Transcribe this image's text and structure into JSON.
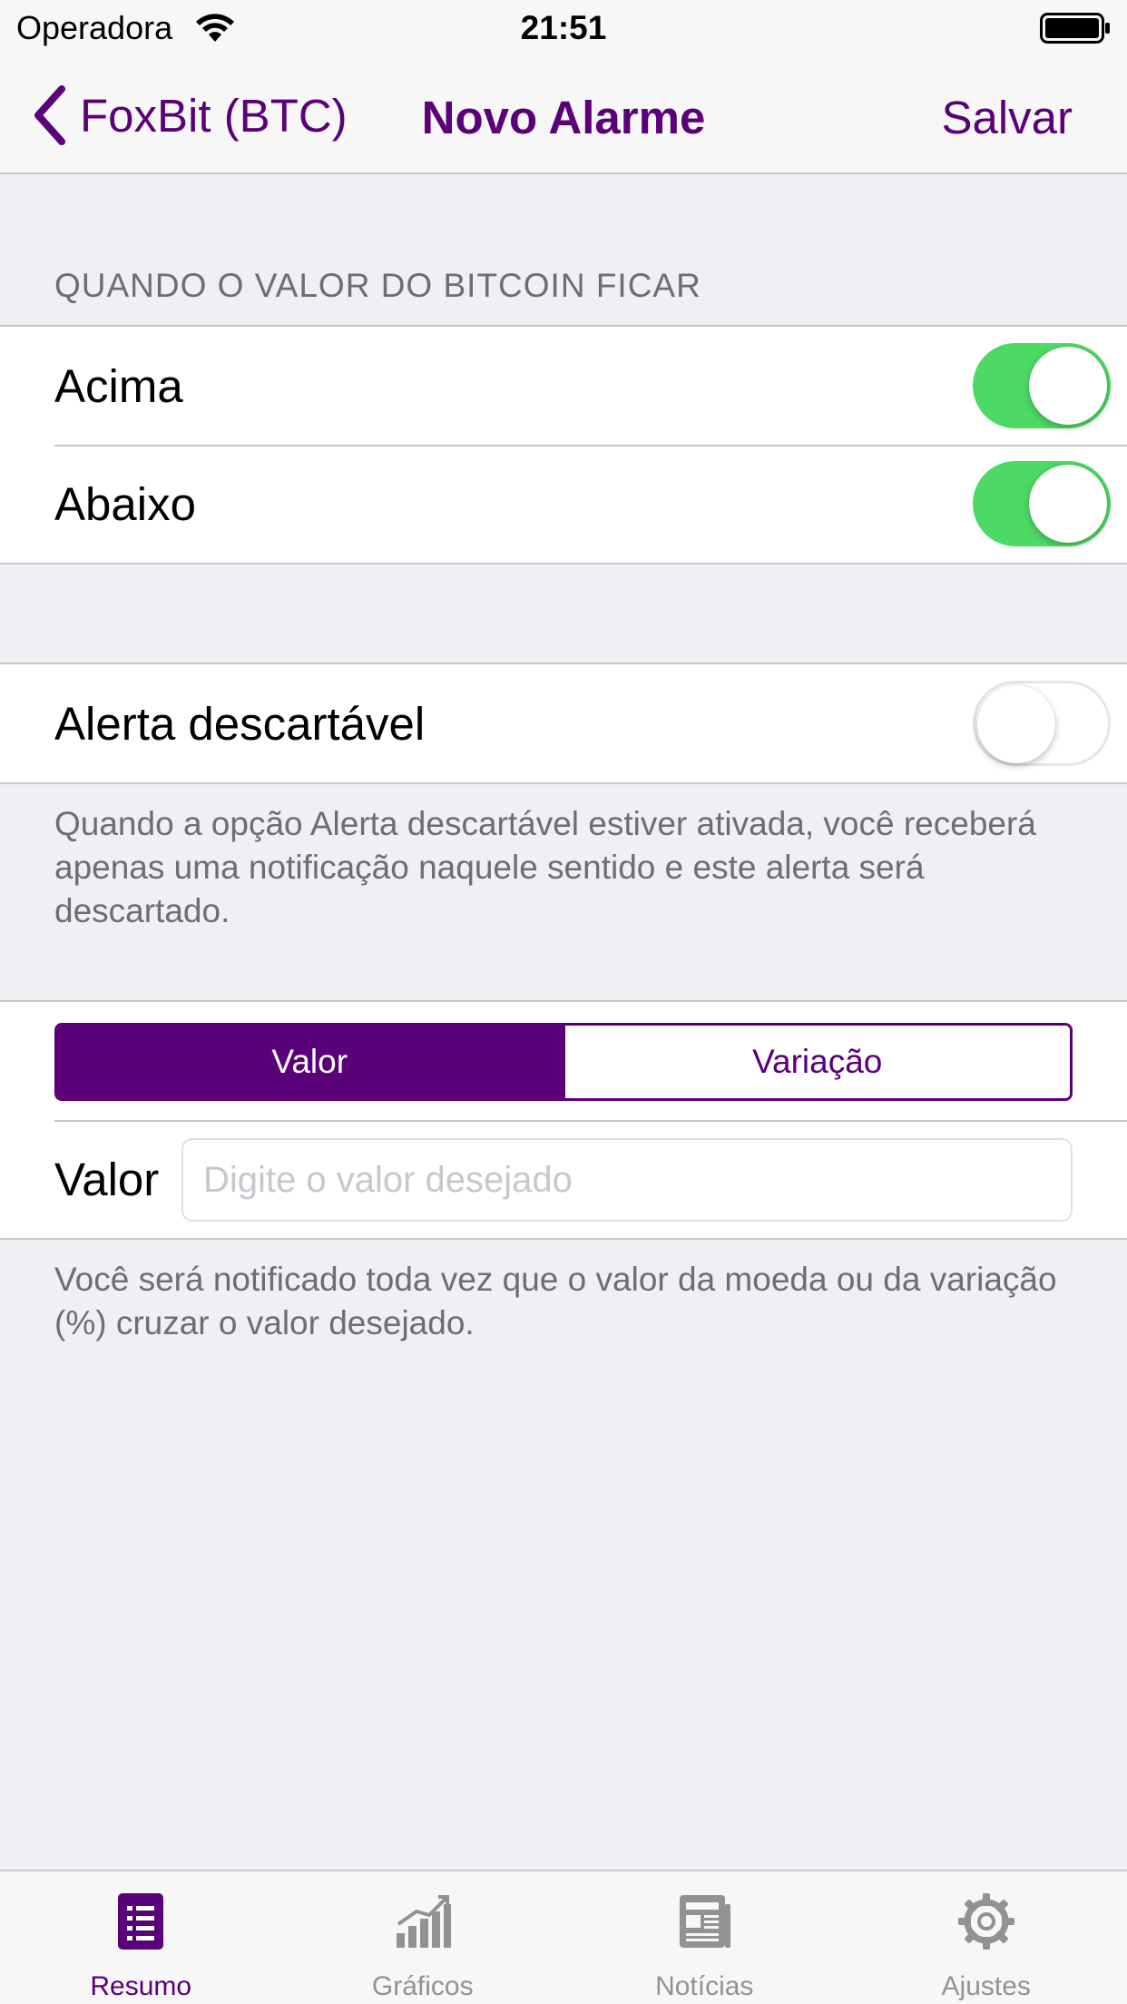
{
  "status_bar": {
    "carrier": "Operadora",
    "time": "21:51",
    "wifi_icon": "wifi-icon",
    "battery_icon": "battery-icon"
  },
  "nav": {
    "back_label": "FoxBit (BTC)",
    "title": "Novo Alarme",
    "save_label": "Salvar",
    "back_icon": "chevron-left-icon"
  },
  "direction_section": {
    "header": "QUANDO O VALOR DO BITCOIN FICAR",
    "rows": [
      {
        "label": "Acima",
        "enabled": true
      },
      {
        "label": "Abaixo",
        "enabled": true
      }
    ]
  },
  "disposable_section": {
    "label": "Alerta descartável",
    "enabled": false,
    "footer": "Quando a opção Alerta descartável estiver ativada, você receberá apenas uma notificação naquele sentido e este alerta será descartado."
  },
  "value_section": {
    "segments": [
      {
        "label": "Valor",
        "selected": true
      },
      {
        "label": "Variação",
        "selected": false
      }
    ],
    "input_label": "Valor",
    "input_value": "",
    "input_placeholder": "Digite o valor desejado",
    "footer": "Você será notificado toda vez que o valor da moeda ou da variação (%) cruzar o valor desejado."
  },
  "tab_bar": {
    "tabs": [
      {
        "label": "Resumo",
        "icon": "list-icon",
        "active": true
      },
      {
        "label": "Gráficos",
        "icon": "bar-chart-icon",
        "active": false
      },
      {
        "label": "Notícias",
        "icon": "newspaper-icon",
        "active": false
      },
      {
        "label": "Ajustes",
        "icon": "gear-icon",
        "active": false
      }
    ]
  },
  "colors": {
    "accent": "#5a0079",
    "toggle_on": "#4cd964",
    "background": "#efeff4",
    "secondary_text": "#6d6d72",
    "tab_inactive": "#929292"
  }
}
